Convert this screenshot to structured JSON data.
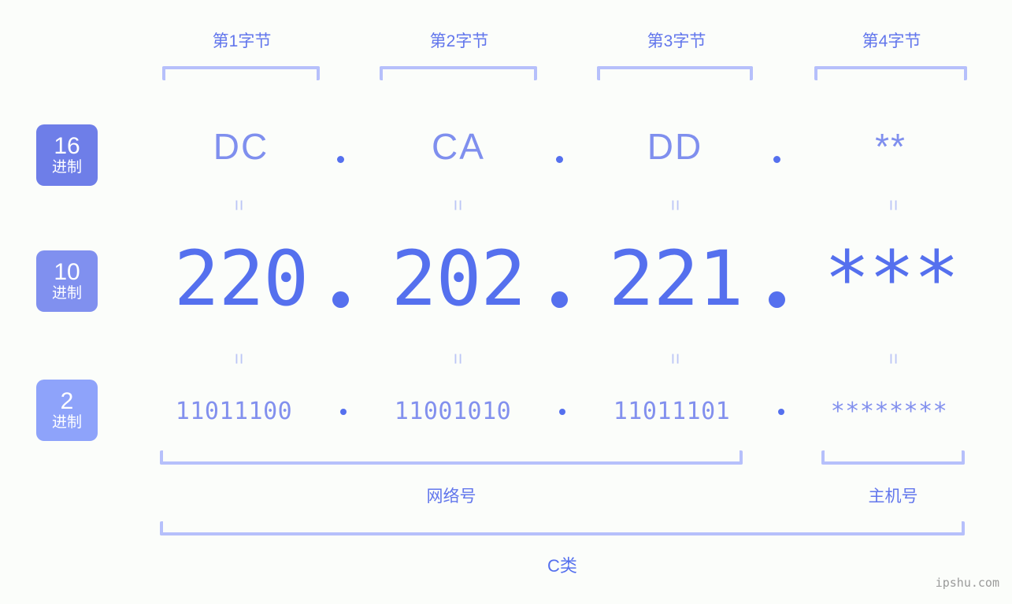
{
  "page": {
    "background": "#fbfdfa",
    "accent": "#5570ee",
    "bracket_color": "#b6c0fb",
    "watermark": "ipshu.com"
  },
  "byte_headers": [
    {
      "label": "第1字节"
    },
    {
      "label": "第2字节"
    },
    {
      "label": "第3字节"
    },
    {
      "label": "第4字节"
    }
  ],
  "rows": {
    "hex": {
      "badge_num": "16",
      "badge_unit": "进制",
      "badge_color": "#6e7ee8",
      "values": [
        "DC",
        "CA",
        "DD",
        "**"
      ],
      "separator": "."
    },
    "dec": {
      "badge_num": "10",
      "badge_unit": "进制",
      "badge_color": "#8090ef",
      "values": [
        "220",
        "202",
        "221",
        "***"
      ],
      "separator": "."
    },
    "bin": {
      "badge_num": "2",
      "badge_unit": "进制",
      "badge_color": "#8ea3fa",
      "values": [
        "11011100",
        "11001010",
        "11011101",
        "********"
      ],
      "separator": "."
    }
  },
  "equals_marks": [
    "=",
    "=",
    "=",
    "=",
    "=",
    "=",
    "=",
    "="
  ],
  "groups": {
    "network": "网络号",
    "host": "主机号",
    "class": "C类"
  }
}
